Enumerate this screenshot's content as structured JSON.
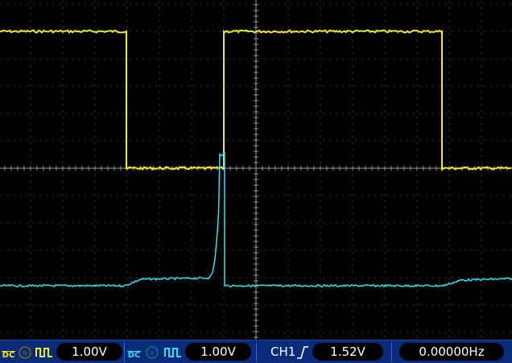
{
  "colors": {
    "ch1": "#f5ea1e",
    "ch2": "#2ee0f0",
    "grid": "#7a7a7a",
    "statusbar": "#0a2a7a"
  },
  "icons": {
    "coupling": "dc-coupling-icon",
    "bw": "bandwidth-limit-icon",
    "invert": "waveform-invert-icon",
    "trigger": "rising-edge-icon"
  },
  "status": {
    "ch1": {
      "coupling": "DC",
      "scale": "1.00V"
    },
    "ch2": {
      "coupling": "DC",
      "scale": "1.00V"
    },
    "trigger": {
      "source": "CH1",
      "level": "1.52V"
    },
    "frequency": "0.00000Hz"
  }
}
